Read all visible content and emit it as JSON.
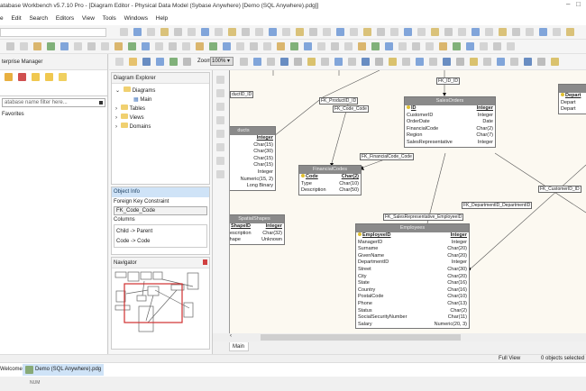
{
  "window": {
    "title": "atabase Workbench v5.7.10 Pro - [Diagram Editor - Physical Data Model (Sybase Anywhere) [Demo (SQL Anywhere).pdg]]"
  },
  "menu": [
    "e",
    "Edit",
    "Search",
    "Editors",
    "View",
    "Tools",
    "Windows",
    "Help"
  ],
  "toolbar": {
    "zoom_label": "Zoom",
    "zoom_value": "100%"
  },
  "enterprise_manager": {
    "title": "terprise Manager",
    "filter_placeholder": "atabase name filter here...",
    "favorites": "Favorites"
  },
  "diagram_explorer": {
    "title": "Diagram Explorer",
    "tree": [
      "Diagrams",
      "Main",
      "Tables",
      "Views",
      "Domains"
    ]
  },
  "object_info": {
    "title": "Object Info",
    "type_label": "Foreign Key Constraint",
    "name_value": "FK_Code_Code",
    "columns_label": "Columns",
    "columns": [
      "Child -> Parent",
      "Code -> Code"
    ]
  },
  "navigator": {
    "title": "Navigator"
  },
  "diagram": {
    "tables": [
      {
        "name": "ducts",
        "rows": [
          [
            "",
            "Integer"
          ],
          [
            "",
            "Char(15)"
          ],
          [
            "",
            "Char(30)"
          ],
          [
            "",
            "Char(15)"
          ],
          [
            "",
            "Char(15)"
          ],
          [
            "",
            "Integer"
          ],
          [
            "",
            "Numeric(15, 2)"
          ],
          [
            "",
            "Long Binary"
          ]
        ]
      },
      {
        "name": "FinancialCodes",
        "rows": [
          [
            "Code",
            "Char(2)"
          ],
          [
            "Type",
            "Char(10)"
          ],
          [
            "Description",
            "Char(50)"
          ]
        ]
      },
      {
        "name": "SalesOrders",
        "rows": [
          [
            "ID",
            "Integer"
          ],
          [
            "CustomerID",
            "Integer"
          ],
          [
            "OrderDate",
            "Date"
          ],
          [
            "FinancialCode",
            "Char(2)"
          ],
          [
            "Region",
            "Char(7)"
          ],
          [
            "SalesRepresentative",
            "Integer"
          ]
        ]
      },
      {
        "name": "",
        "rows": [
          [
            "Depart",
            ""
          ],
          [
            "Depart",
            ""
          ],
          [
            "Depart",
            ""
          ]
        ]
      },
      {
        "name": "SpatialShapes",
        "rows": [
          [
            "ShapeID",
            "Integer"
          ],
          [
            "Description",
            "Char(32)"
          ],
          [
            "Shape",
            "Unknown"
          ]
        ]
      },
      {
        "name": "Employees",
        "rows": [
          [
            "EmployeeID",
            "Integer"
          ],
          [
            "ManagerID",
            "Integer"
          ],
          [
            "Surname",
            "Char(20)"
          ],
          [
            "GivenName",
            "Char(20)"
          ],
          [
            "DepartmentID",
            "Integer"
          ],
          [
            "Street",
            "Char(30)"
          ],
          [
            "City",
            "Char(20)"
          ],
          [
            "State",
            "Char(16)"
          ],
          [
            "Country",
            "Char(16)"
          ],
          [
            "PostalCode",
            "Char(10)"
          ],
          [
            "Phone",
            "Char(13)"
          ],
          [
            "Status",
            "Char(2)"
          ],
          [
            "SocialSecurityNumber",
            "Char(11)"
          ],
          [
            "Salary",
            "Numeric(20, 3)"
          ]
        ]
      }
    ],
    "fk_labels": [
      "ductID_ID",
      "FK_ProductID_ID",
      "FK_Code_Code",
      "FK_ID_ID",
      "FK_FinancialCode_Code",
      "FK_CustomerID_ID",
      "FK_DepartmentID_DepartmentID",
      "FK_SalesRepresentative_EmployeeID"
    ],
    "tab": "Main"
  },
  "status": {
    "view": "Full View",
    "selection": "0 objects selected",
    "num": "NUM"
  },
  "doc_tabs": [
    "Welcome",
    "Demo (SQL Anywhere).pdg"
  ],
  "colors": {
    "accent": "#cfe3f7",
    "canvas": "#fcf9f1",
    "table_header": "#8a8a8a",
    "navigator_frame": "#d03030"
  }
}
